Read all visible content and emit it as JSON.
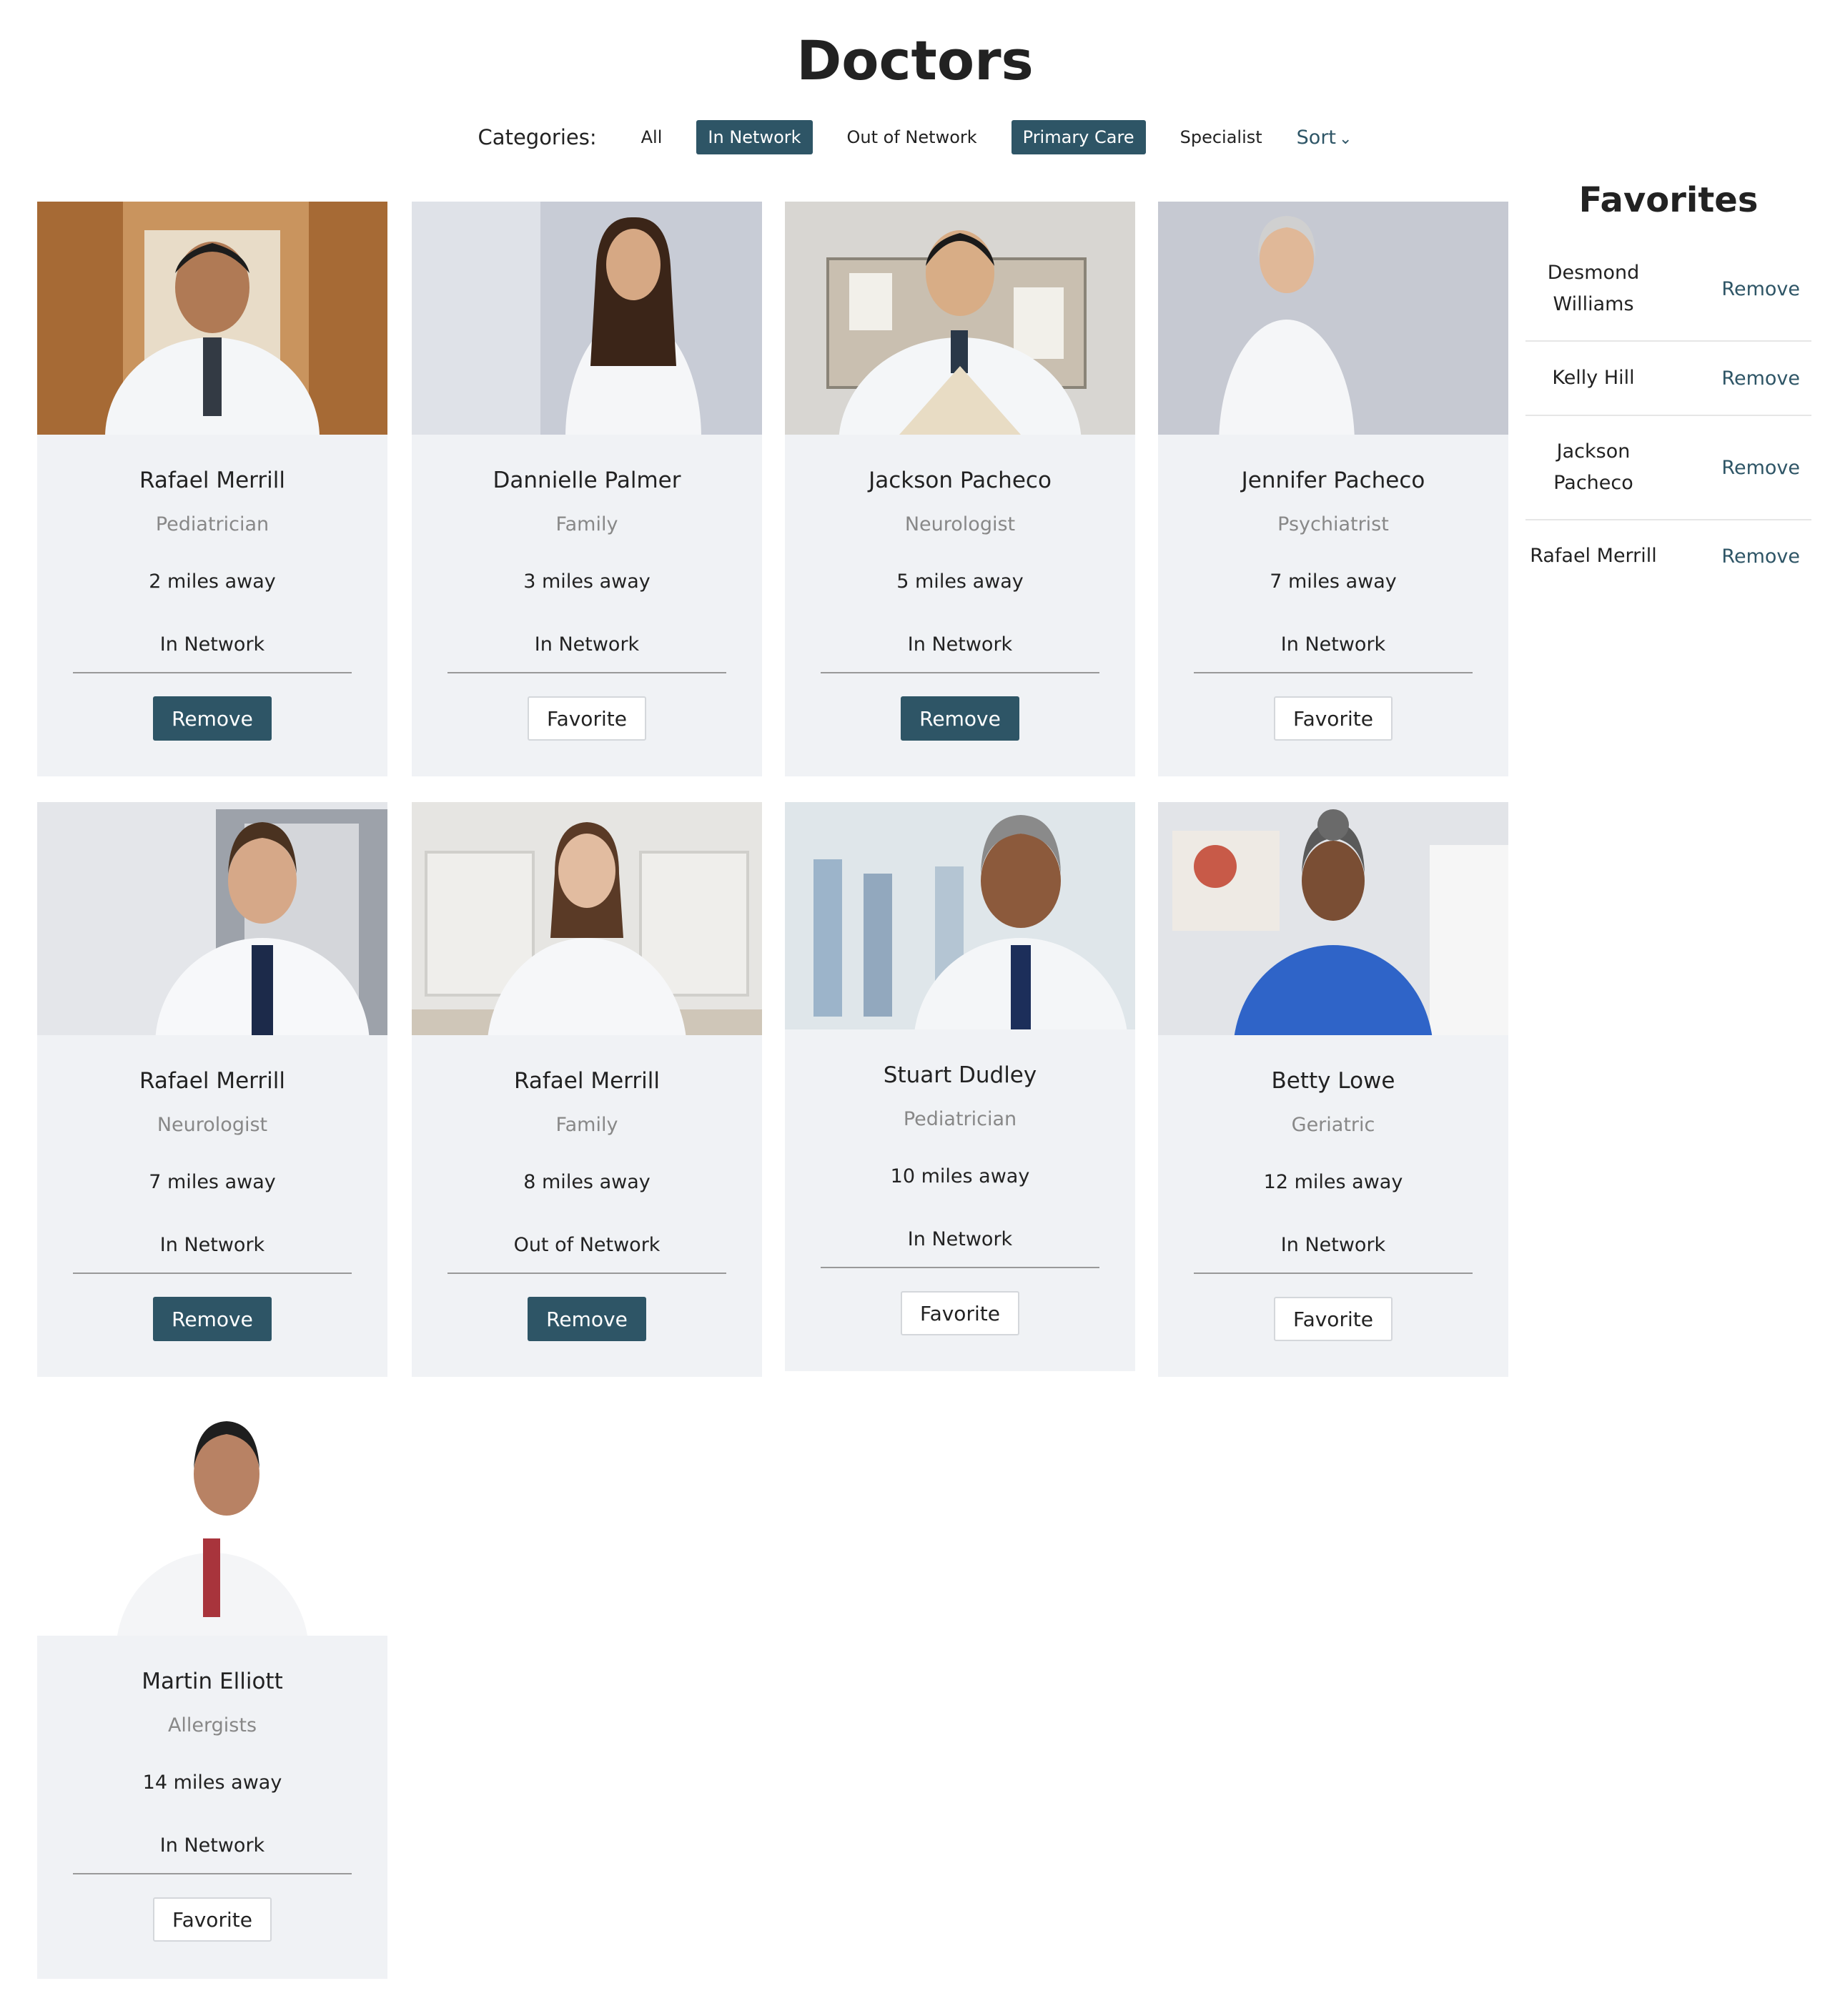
{
  "page": {
    "title": "Doctors"
  },
  "filters": {
    "label": "Categories:",
    "chips": [
      {
        "label": "All",
        "active": false
      },
      {
        "label": "In Network",
        "active": true
      },
      {
        "label": "Out of Network",
        "active": false
      },
      {
        "label": "Primary Care",
        "active": true
      },
      {
        "label": "Specialist",
        "active": false
      }
    ],
    "sort_label": "Sort"
  },
  "doctors": [
    {
      "name": "Rafael Merrill",
      "specialty": "Pediatrician",
      "distance": "2 miles away",
      "network": "In Network",
      "action": "Remove"
    },
    {
      "name": "Dannielle Palmer",
      "specialty": "Family",
      "distance": "3 miles away",
      "network": "In Network",
      "action": "Favorite"
    },
    {
      "name": "Jackson Pacheco",
      "specialty": "Neurologist",
      "distance": "5 miles away",
      "network": "In Network",
      "action": "Remove"
    },
    {
      "name": "Jennifer Pacheco",
      "specialty": "Psychiatrist",
      "distance": "7 miles away",
      "network": "In Network",
      "action": "Favorite"
    },
    {
      "name": "Rafael Merrill",
      "specialty": "Neurologist",
      "distance": "7 miles away",
      "network": "In Network",
      "action": "Remove"
    },
    {
      "name": "Rafael Merrill",
      "specialty": "Family",
      "distance": "8 miles away",
      "network": "Out of Network",
      "action": "Remove"
    },
    {
      "name": "Stuart Dudley",
      "specialty": "Pediatrician",
      "distance": "10 miles away",
      "network": "In Network",
      "action": "Favorite"
    },
    {
      "name": "Betty Lowe",
      "specialty": "Geriatric",
      "distance": "12 miles away",
      "network": "In Network",
      "action": "Favorite"
    },
    {
      "name": "Martin Elliott",
      "specialty": "Allergists",
      "distance": "14 miles away",
      "network": "In Network",
      "action": "Favorite"
    }
  ],
  "favorites": {
    "title": "Favorites",
    "items": [
      {
        "name": "Desmond Williams",
        "action": "Remove"
      },
      {
        "name": "Kelly Hill",
        "action": "Remove"
      },
      {
        "name": "Jackson Pacheco",
        "action": "Remove"
      },
      {
        "name": "Rafael Merrill",
        "action": "Remove"
      }
    ]
  },
  "colors": {
    "accent": "#2e5566",
    "card_background": "#f0f2f5",
    "muted_text": "#888888"
  },
  "icons": {
    "sort": "chevron-down-icon",
    "photo": "doctor-photo"
  }
}
